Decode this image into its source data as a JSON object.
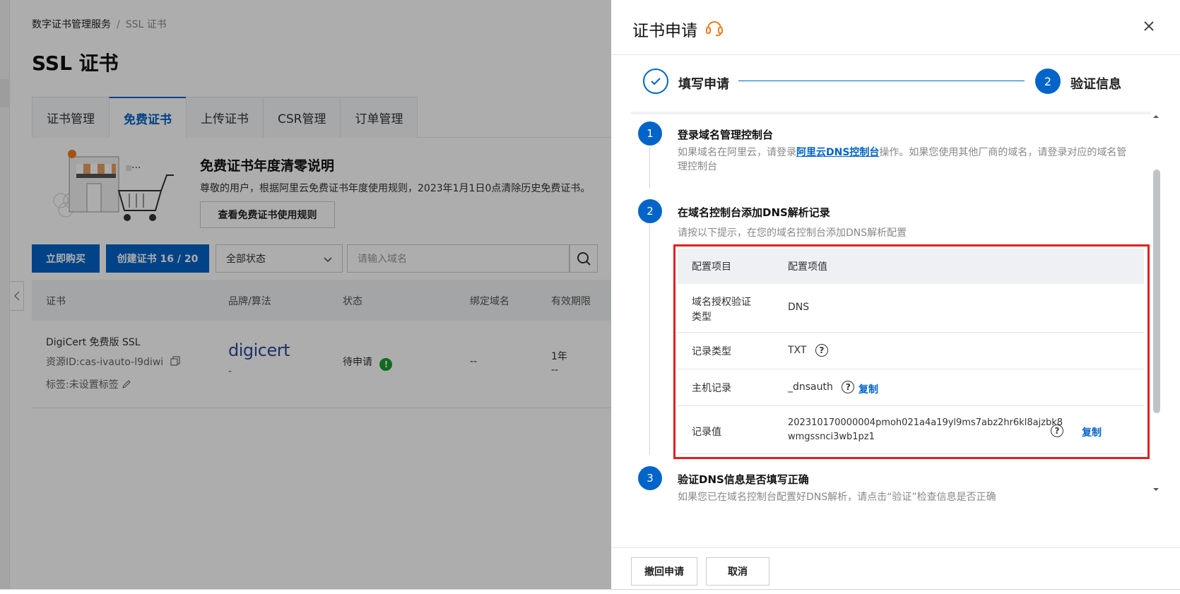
{
  "breadcrumb": {
    "root": "数字证书管理服务",
    "separator": "/",
    "current": "SSL 证书"
  },
  "page_title": "SSL 证书",
  "tabs": [
    {
      "label": "证书管理",
      "active": false
    },
    {
      "label": "免费证书",
      "active": true
    },
    {
      "label": "上传证书",
      "active": false
    },
    {
      "label": "CSR管理",
      "active": false
    },
    {
      "label": "订单管理",
      "active": false
    }
  ],
  "banner": {
    "title": "免费证书年度清零说明",
    "desc": "尊敬的用户，根据阿里云免费证书年度使用规则，2023年1月1日0点清除历史免费证书。",
    "button": "查看免费证书使用规则"
  },
  "toolbar": {
    "buy_button": "立即购买",
    "create_button": "创建证书 16 / 20",
    "status_select": "全部状态",
    "search_placeholder": "请输入域名"
  },
  "table": {
    "headers": [
      "证书",
      "品牌/算法",
      "状态",
      "绑定域名",
      "有效期限"
    ],
    "rows": [
      {
        "name": "DigiCert 免费版 SSL",
        "resource_id": "资源ID:cas-ivauto-l9diwi",
        "tag": "标签:未设置标签",
        "brand": "digicert",
        "algo": "-",
        "status": "待申请",
        "domain": "--",
        "validity": "1年",
        "validity_sub": "--"
      }
    ]
  },
  "drawer": {
    "title": "证书申请",
    "steps": [
      {
        "label": "填写申请",
        "state": "done"
      },
      {
        "num": "2",
        "label": "验证信息",
        "state": "current"
      }
    ],
    "sections": [
      {
        "num": "1",
        "title": "登录域名管理控制台",
        "desc_pre": "如果域名在阿里云，请登录",
        "desc_link": "阿里云DNS控制台",
        "desc_post": "操作。如果您使用其他厂商的域名，请登录对应的域名管理控制台"
      },
      {
        "num": "2",
        "title": "在域名控制台添加DNS解析记录",
        "desc": "请按以下提示，在您的域名控制台添加DNS解析配置"
      },
      {
        "num": "3",
        "title": "验证DNS信息是否填写正确",
        "desc": "如果您已在域名控制台配置好DNS解析，请点击“验证”检查信息是否正确"
      }
    ],
    "config_table": {
      "header_key": "配置项目",
      "header_value": "配置项值",
      "rows": [
        {
          "key_line1": "域名授权验证",
          "key_line2": "类型",
          "value": "DNS"
        },
        {
          "key": "记录类型",
          "value": "TXT"
        },
        {
          "key": "主机记录",
          "value": "_dnsauth",
          "copy": "复制"
        },
        {
          "key": "记录值",
          "value_line1": "202310170000004pmoh021a4a19yl9ms7abz2hr6kl8ajzbk8",
          "value_line2": "wmgssnci3wb1pz1",
          "copy": "复制"
        }
      ]
    },
    "footer": {
      "withdraw": "撤回申请",
      "cancel": "取消"
    }
  },
  "colors": {
    "primary": "#0064c8",
    "highlight_frame": "#e02020",
    "status_ok": "#1a9c2e",
    "support_icon": "#f07c1e"
  }
}
